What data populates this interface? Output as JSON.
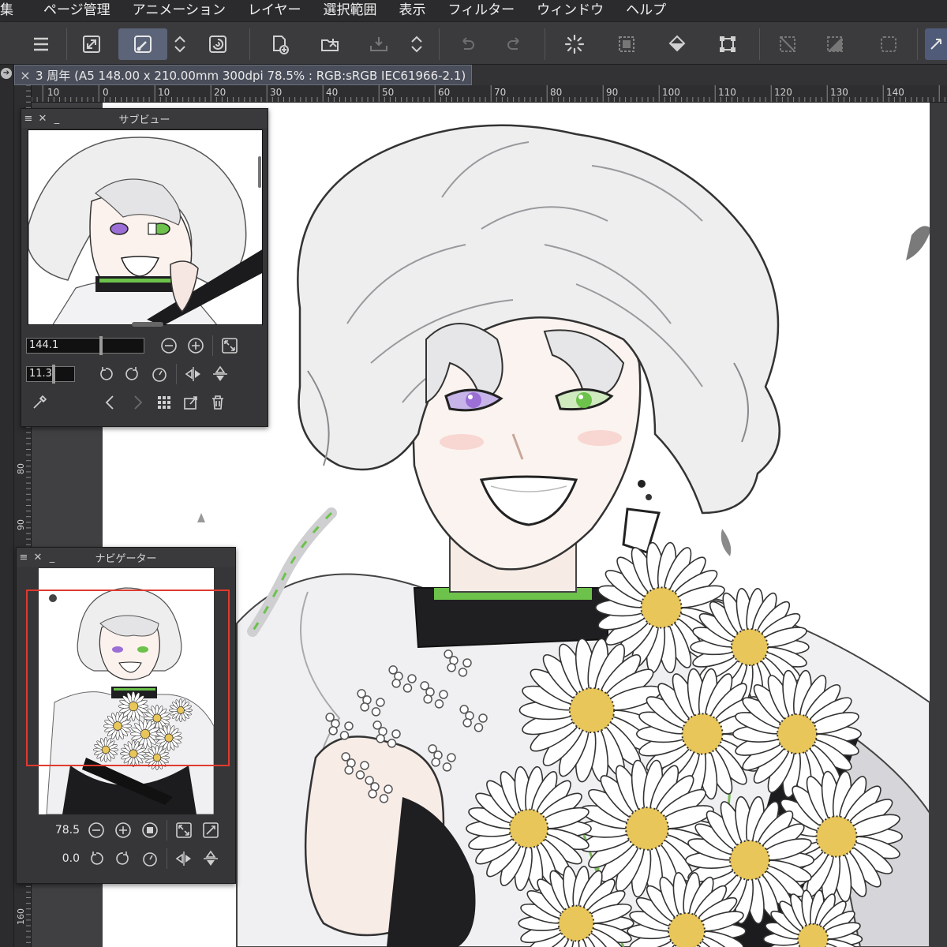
{
  "menu": {
    "items": [
      "集",
      "ページ管理",
      "アニメーション",
      "レイヤー",
      "選択範囲",
      "表示",
      "フィルター",
      "ウィンドウ",
      "ヘルプ"
    ]
  },
  "toolbar": {
    "icons": [
      "menu-icon",
      "fullscreen-icon",
      "active-tool-icon",
      "chevron-updown-icon",
      "ring-icon",
      "new-file-icon",
      "open-folder-icon",
      "save-icon",
      "chevron-updown-icon",
      "undo-icon",
      "redo-icon",
      "loading-spinner-icon",
      "selection-marquee-icon",
      "fill-bucket-icon",
      "transform-icon",
      "clear-selection-icon",
      "invert-selection-icon",
      "selection-icon",
      "layout-icon"
    ]
  },
  "document": {
    "tab_title": "3 周年 (A5 148.00 x 210.00mm 300dpi 78.5% : RGB:sRGB IEC61966-2.1)"
  },
  "rulers": {
    "horizontal": [
      "10",
      "0",
      "10",
      "20",
      "30",
      "40",
      "50",
      "60",
      "70",
      "80",
      "90",
      "100",
      "110",
      "120",
      "130",
      "140"
    ],
    "vertical": [
      "80",
      "90",
      "160"
    ]
  },
  "subview": {
    "title": "サブビュー",
    "zoom_value": "144.1",
    "rotate_value": "11.3"
  },
  "navigator": {
    "title": "ナビゲーター",
    "zoom_value": "78.5",
    "rotate_value": "0.0"
  },
  "colors": {
    "app_bg": "#3a3a3c",
    "accent_selected": "#5b6478",
    "navigator_frame": "#e03a2f",
    "eye_purple": "#9b6fd6",
    "eye_green": "#6cc24a",
    "daisy_center": "#e8c65a"
  }
}
